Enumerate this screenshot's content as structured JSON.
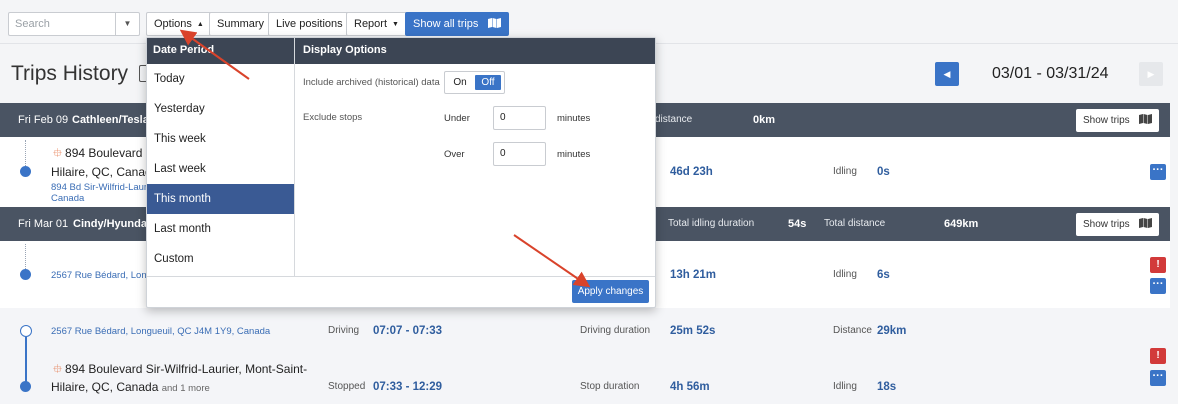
{
  "toolbar": {
    "search_placeholder": "Search",
    "options_label": "Options",
    "summary_label": "Summary",
    "live_positions_label": "Live positions",
    "report_label": "Report",
    "show_all_trips_label": "Show all trips"
  },
  "header": {
    "title": "Trips History",
    "date_range": "03/01 - 03/31/24"
  },
  "groups": [
    {
      "date": "Fri Feb 09",
      "name": "Cathleen/Tesla",
      "distance_label": "distance",
      "distance_value": "0km",
      "show_trips_label": "Show trips",
      "row": {
        "place_line1": "894 Boulevard S",
        "place_line2": "Hilaire, QC, Canada",
        "address_line1": "894 Bd Sir-Wilfrid-Laurier",
        "address_line2": "Canada",
        "duration": "46d 23h",
        "idling_label": "Idling",
        "idling_value": "0s"
      }
    },
    {
      "date": "Fri Mar 01",
      "name": "Cindy/Hyundai",
      "idling_label": "Total idling duration",
      "idling_value": "54s",
      "distance_label": "Total distance",
      "distance_value": "649km",
      "show_trips_label": "Show trips",
      "rows": [
        {
          "address": "2567 Rue Bédard, Longue",
          "duration": "13h 21m",
          "idling_label": "Idling",
          "idling_value": "6s"
        },
        {
          "address": "2567 Rue Bédard, Longueuil, QC J4M 1Y9, Canada",
          "status": "Driving",
          "time": "07:07 - 07:33",
          "duration_label": "Driving duration",
          "duration": "25m 52s",
          "distance_label": "Distance",
          "distance_value": "29km"
        },
        {
          "place_line1": "894 Boulevard Sir-Wilfrid-Laurier, Mont-Saint-",
          "place_line2": "Hilaire, QC, Canada",
          "more": "and 1 more",
          "status": "Stopped",
          "time": "07:33 - 12:29",
          "duration_label": "Stop duration",
          "duration": "4h 56m",
          "idling_label": "Idling",
          "idling_value": "18s"
        }
      ]
    }
  ],
  "options_panel": {
    "date_period_heading": "Date Period",
    "display_options_heading": "Display Options",
    "periods": [
      "Today",
      "Yesterday",
      "This week",
      "Last week",
      "This month",
      "Last month",
      "Custom"
    ],
    "selected_period": "This month",
    "include_archived_label": "Include archived (historical) data",
    "toggle_on": "On",
    "toggle_off": "Off",
    "toggle_state": "Off",
    "exclude_stops_label": "Exclude stops",
    "under_label": "Under",
    "under_value": "0",
    "over_label": "Over",
    "over_value": "0",
    "minutes_label": "minutes",
    "apply_label": "Apply changes"
  },
  "colors": {
    "accent": "#3a74c7",
    "header_bar": "#4a5463",
    "selected_item": "#3a5a94",
    "warning": "#d23a3a",
    "annotation_arrow": "#d9432b"
  }
}
